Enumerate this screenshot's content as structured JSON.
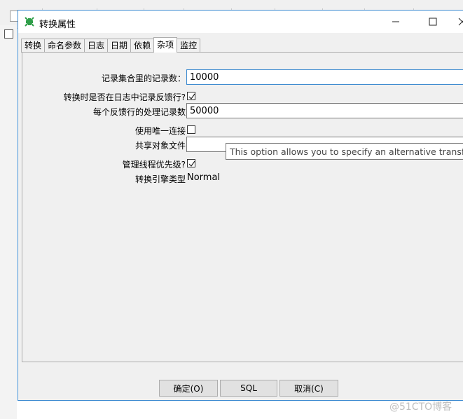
{
  "dialog": {
    "title": "转换属性",
    "tabs": [
      "转换",
      "命名参数",
      "日志",
      "日期",
      "依赖",
      "杂项",
      "监控"
    ],
    "active_tab": "杂项"
  },
  "form": {
    "record_count_label": "记录集合里的记录数：",
    "record_count_value": "10000",
    "log_feedback_label": "转换时是否在日志中记录反馈行?",
    "log_feedback_checked": true,
    "feedback_rows_label": "每个反馈行的处理记录数",
    "feedback_rows_value": "50000",
    "unique_conn_label": "使用唯一连接",
    "unique_conn_checked": false,
    "shared_objects_label": "共享对象文件",
    "shared_objects_value": "",
    "thread_priority_label": "管理线程优先级?",
    "thread_priority_checked": true,
    "engine_type_label": "转换引擎类型",
    "engine_type_value": "Normal",
    "tooltip": "This option allows you to specify an alternative transformation engine"
  },
  "buttons": {
    "ok": "确定(O)",
    "sql": "SQL",
    "cancel": "取消(C)"
  },
  "watermark": "@51CTO博客"
}
